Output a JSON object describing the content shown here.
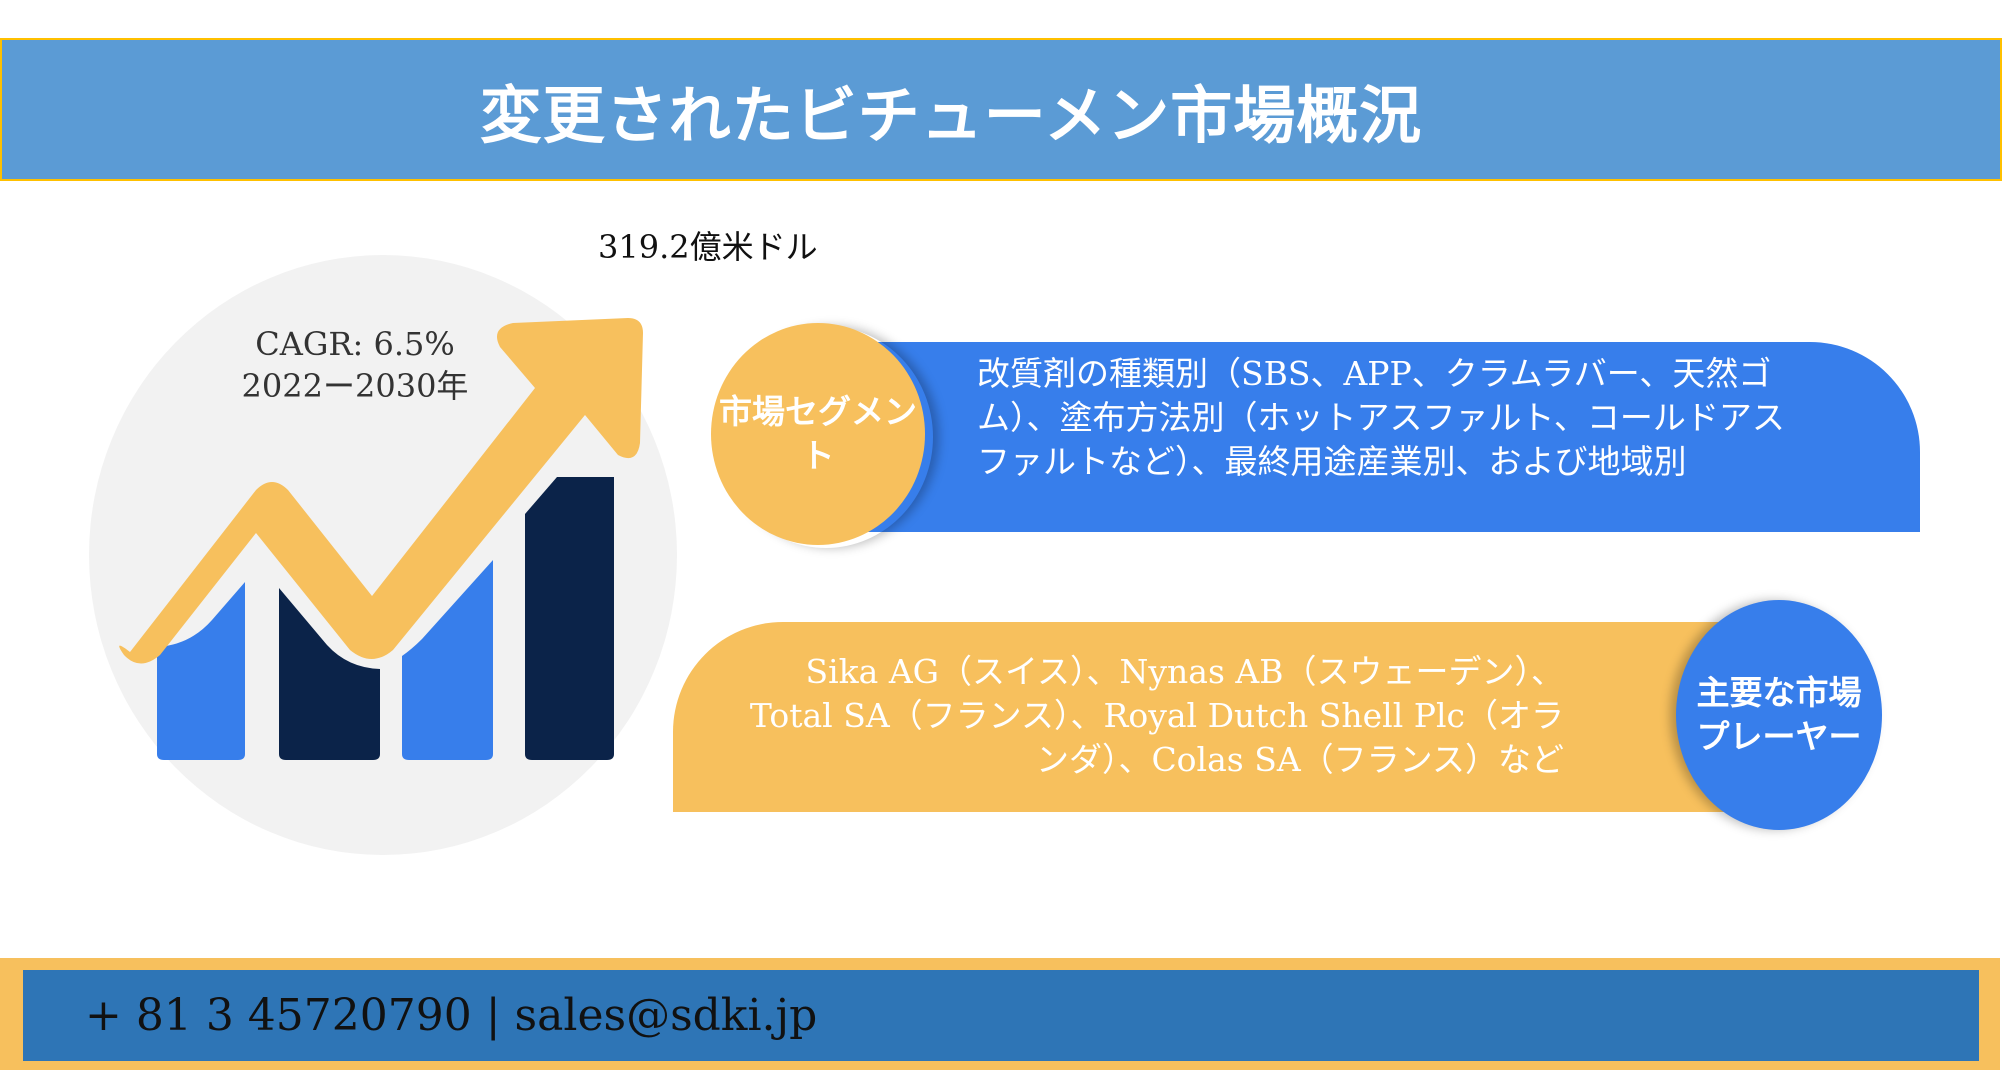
{
  "header": {
    "title": "変更されたビチューメン市場概況"
  },
  "chart_illustration": {
    "market_value": "319.2億米ドル",
    "cagr": "CAGR: 6.5%",
    "period": "2022ー2030年",
    "icon": "growth-bar-chart-with-up-arrow",
    "colors": {
      "circle": "#F2F2F2",
      "arrow": "#F7C05D",
      "bar_light": "#377EEB",
      "bar_dark": "#0B2349"
    }
  },
  "segment": {
    "heading": "市場セグメント",
    "text": "改質剤の種類別（SBS、APP、クラムラバー、天然ゴム）、塗布方法別（ホットアスファルト、コールドアスファルトなど）、最終用途産業別、および地域別",
    "colors": {
      "bar": "#377EEB",
      "badge": "#F7C05D"
    }
  },
  "players": {
    "heading": "主要な市場プレーヤー",
    "text": "Sika AG（スイス）、Nynas AB（スウェーデン）、Total SA（フランス）、Royal Dutch Shell Plc（オランダ）、Colas SA（フランス）など",
    "colors": {
      "bar": "#F7C05D",
      "badge": "#377EEB"
    }
  },
  "footer": {
    "contact": "+ 81 3 45720790 | sales@sdki.jp",
    "colors": {
      "frame": "#F7C05D",
      "fill": "#2E75B6"
    }
  },
  "theme": {
    "title_bar": "#5B9BD5",
    "title_border": "#FFC000"
  }
}
